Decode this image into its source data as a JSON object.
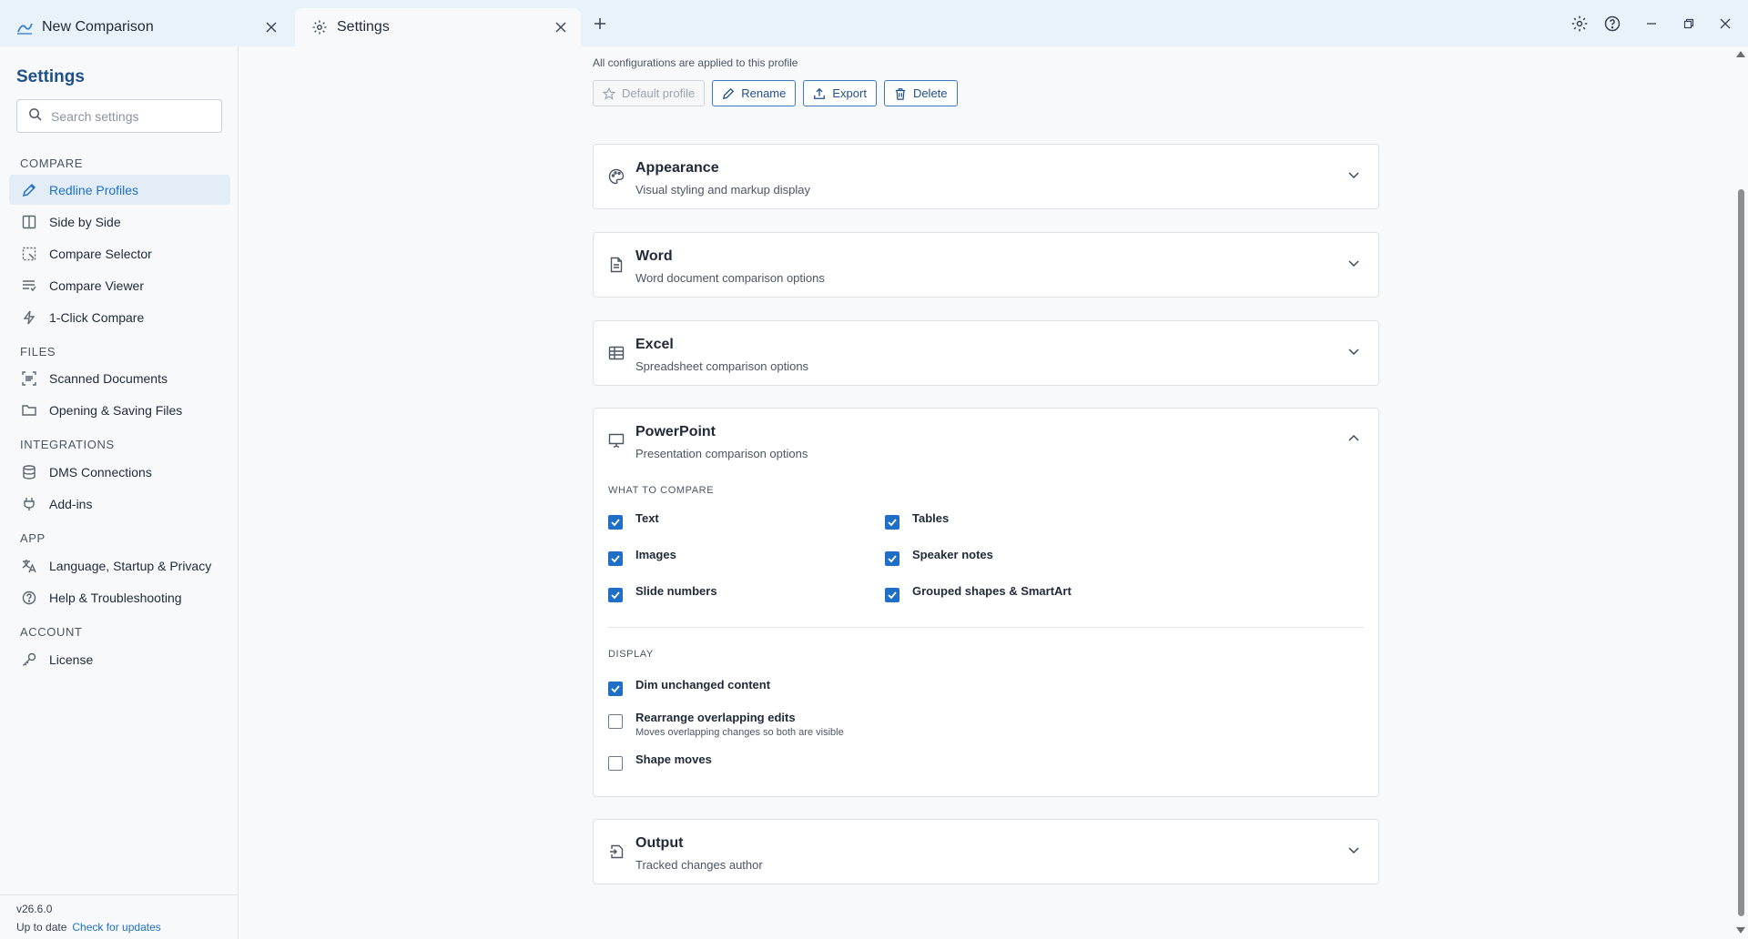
{
  "tabs": [
    {
      "label": "New Comparison",
      "icon": "compare-app-icon"
    },
    {
      "label": "Settings",
      "icon": "gear-icon",
      "active": true
    }
  ],
  "window": {
    "toolbar_icons": [
      "settings-gear-icon",
      "help-circle-icon"
    ],
    "controls": [
      "minimize-icon",
      "restore-icon",
      "close-icon"
    ]
  },
  "sidebar": {
    "title": "Settings",
    "search_placeholder": "Search settings",
    "sections": [
      {
        "label": "COMPARE",
        "items": [
          {
            "label": "Redline Profiles",
            "icon": "pencil-icon",
            "active": true
          },
          {
            "label": "Side by Side",
            "icon": "columns-icon"
          },
          {
            "label": "Compare Selector",
            "icon": "selection-icon"
          },
          {
            "label": "Compare Viewer",
            "icon": "list-check-icon"
          },
          {
            "label": "1-Click Compare",
            "icon": "lightning-icon"
          }
        ]
      },
      {
        "label": "FILES",
        "items": [
          {
            "label": "Scanned Documents",
            "icon": "scan-icon"
          },
          {
            "label": "Opening & Saving Files",
            "icon": "folder-icon"
          }
        ]
      },
      {
        "label": "INTEGRATIONS",
        "items": [
          {
            "label": "DMS Connections",
            "icon": "database-icon"
          },
          {
            "label": "Add-ins",
            "icon": "plug-icon"
          }
        ]
      },
      {
        "label": "APP",
        "items": [
          {
            "label": "Language, Startup & Privacy",
            "icon": "translate-icon"
          },
          {
            "label": "Help & Troubleshooting",
            "icon": "help-icon"
          }
        ]
      },
      {
        "label": "ACCOUNT",
        "items": [
          {
            "label": "License",
            "icon": "key-icon"
          }
        ]
      }
    ],
    "footer": {
      "version": "v26.6.0",
      "status": "Up to date",
      "update_link": "Check for updates"
    }
  },
  "profile": {
    "note": "All configurations are applied to this profile",
    "buttons": {
      "default": "Default profile",
      "rename": "Rename",
      "export": "Export",
      "delete": "Delete"
    }
  },
  "cards": {
    "appearance": {
      "title": "Appearance",
      "subtitle": "Visual styling and markup display",
      "icon": "palette-icon",
      "expanded": false
    },
    "word": {
      "title": "Word",
      "subtitle": "Word document comparison options",
      "icon": "document-icon",
      "expanded": false
    },
    "excel": {
      "title": "Excel",
      "subtitle": "Spreadsheet comparison options",
      "icon": "table-icon",
      "expanded": false
    },
    "powerpoint": {
      "title": "PowerPoint",
      "subtitle": "Presentation comparison options",
      "icon": "presentation-icon",
      "expanded": true,
      "what_to_compare_label": "WHAT TO COMPARE",
      "compare_options": [
        {
          "label": "Text",
          "checked": true
        },
        {
          "label": "Tables",
          "checked": true
        },
        {
          "label": "Images",
          "checked": true
        },
        {
          "label": "Speaker notes",
          "checked": true
        },
        {
          "label": "Slide numbers",
          "checked": true
        },
        {
          "label": "Grouped shapes & SmartArt",
          "checked": true
        }
      ],
      "display_label": "DISPLAY",
      "display_options": [
        {
          "label": "Dim unchanged content",
          "checked": true
        },
        {
          "label": "Rearrange overlapping edits",
          "description": "Moves overlapping changes so both are visible",
          "checked": false
        },
        {
          "label": "Shape moves",
          "checked": false
        }
      ]
    },
    "output": {
      "title": "Output",
      "subtitle": "Tracked changes author",
      "icon": "output-icon",
      "expanded": false
    }
  },
  "colors": {
    "accent": "#1f6fc5",
    "titlebar": "#e9f2fb",
    "active_nav_bg": "#e3edf8"
  }
}
